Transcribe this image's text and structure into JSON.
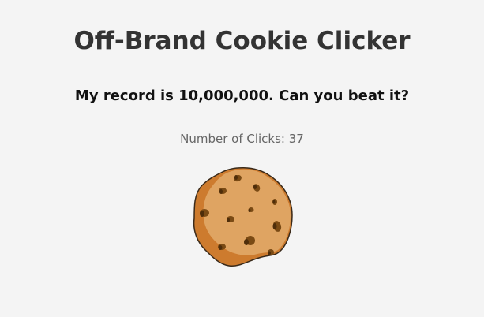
{
  "page": {
    "title": "Off-Brand Cookie Clicker",
    "record_text": "My record is 10,000,000. Can you beat it?",
    "counter_label": "Number of Clicks: ",
    "click_count": "37"
  },
  "cookie": {
    "icon": "cookie-icon",
    "colors": {
      "outline": "#3a2a1a",
      "base": "#cd7b2e",
      "surface": "#dfa462",
      "chip": "#7a4a14",
      "chip_dark": "#4e2d0a"
    }
  }
}
